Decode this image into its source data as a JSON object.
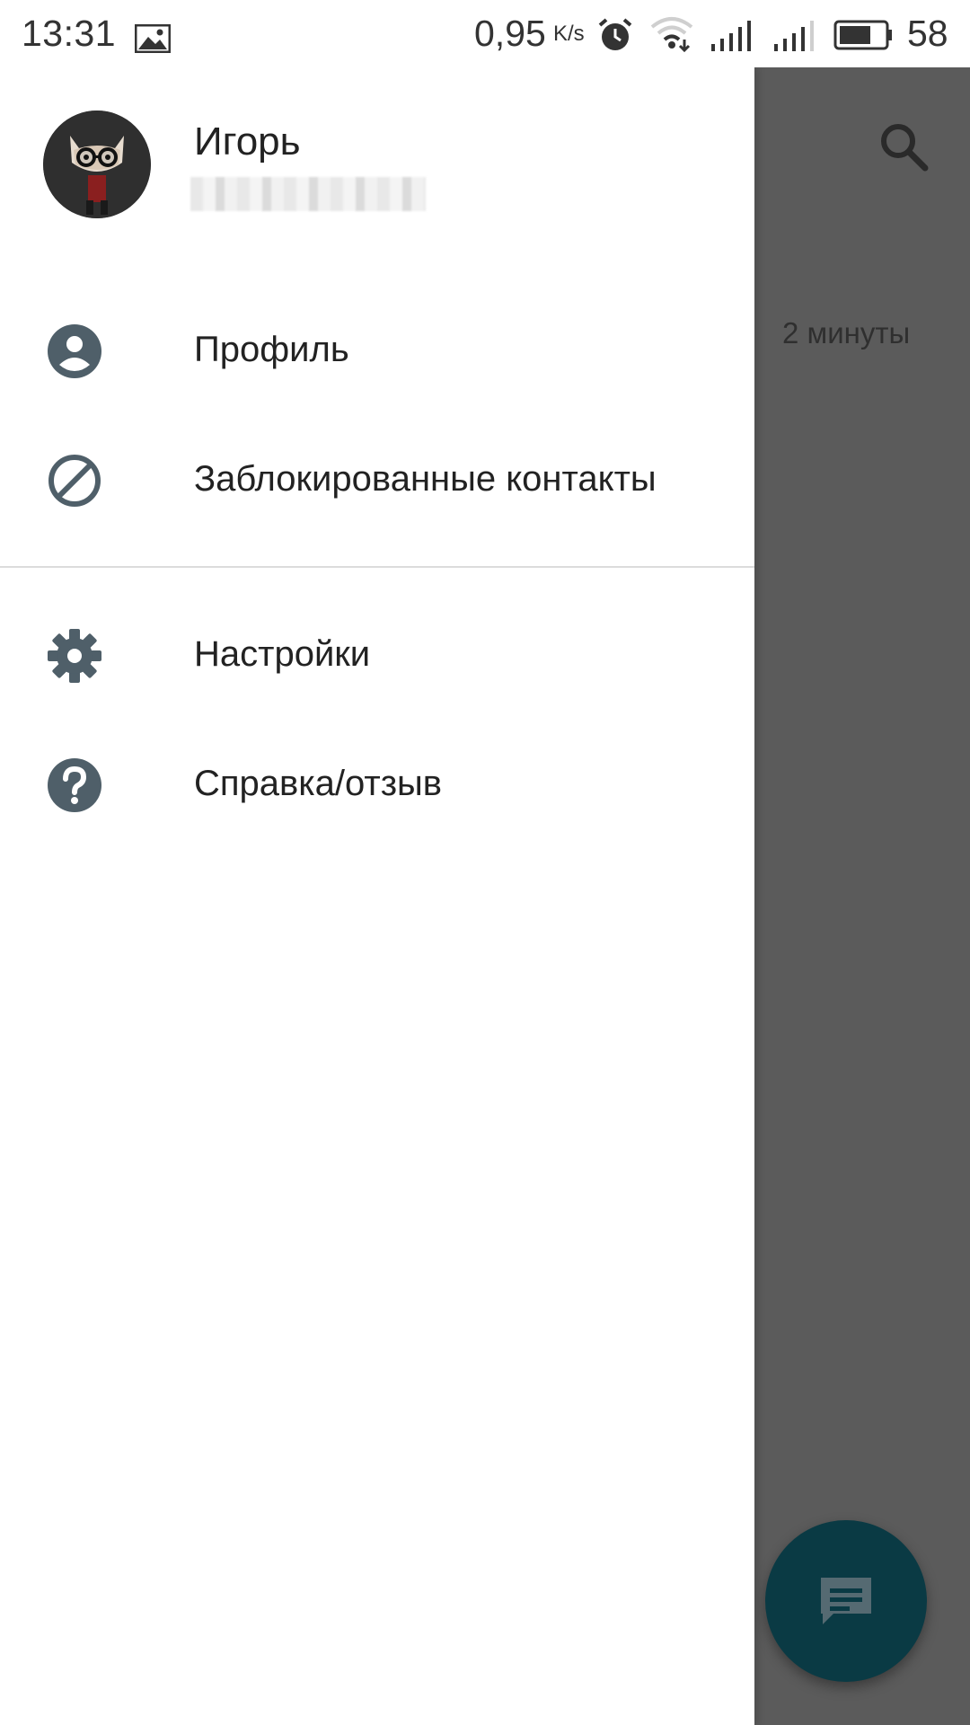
{
  "status_bar": {
    "time": "13:31",
    "network_speed": "0,95",
    "network_speed_unit": "K/s",
    "battery_level": "58",
    "icons": [
      "gallery-icon",
      "alarm-icon",
      "wifi-icon",
      "signal-icon",
      "signal-icon",
      "battery-icon"
    ]
  },
  "drawer": {
    "user": {
      "name": "Игорь",
      "avatar_icon": "avatar-cat-glasses"
    },
    "menu_items": [
      {
        "label": "Профиль",
        "icon": "profile-icon"
      },
      {
        "label": "Заблокированные контакты",
        "icon": "block-icon"
      },
      {
        "label": "Настройки",
        "icon": "gear-icon"
      },
      {
        "label": "Справка/отзыв",
        "icon": "help-icon"
      }
    ]
  },
  "background": {
    "chat_time": "2 минуты",
    "search_icon": "search-icon",
    "fab_icon": "chat-icon"
  },
  "colors": {
    "icon_gray": "#4f5f69",
    "overlay": "#5b5b5b",
    "fab": "#0a3a44",
    "text": "#222222"
  }
}
